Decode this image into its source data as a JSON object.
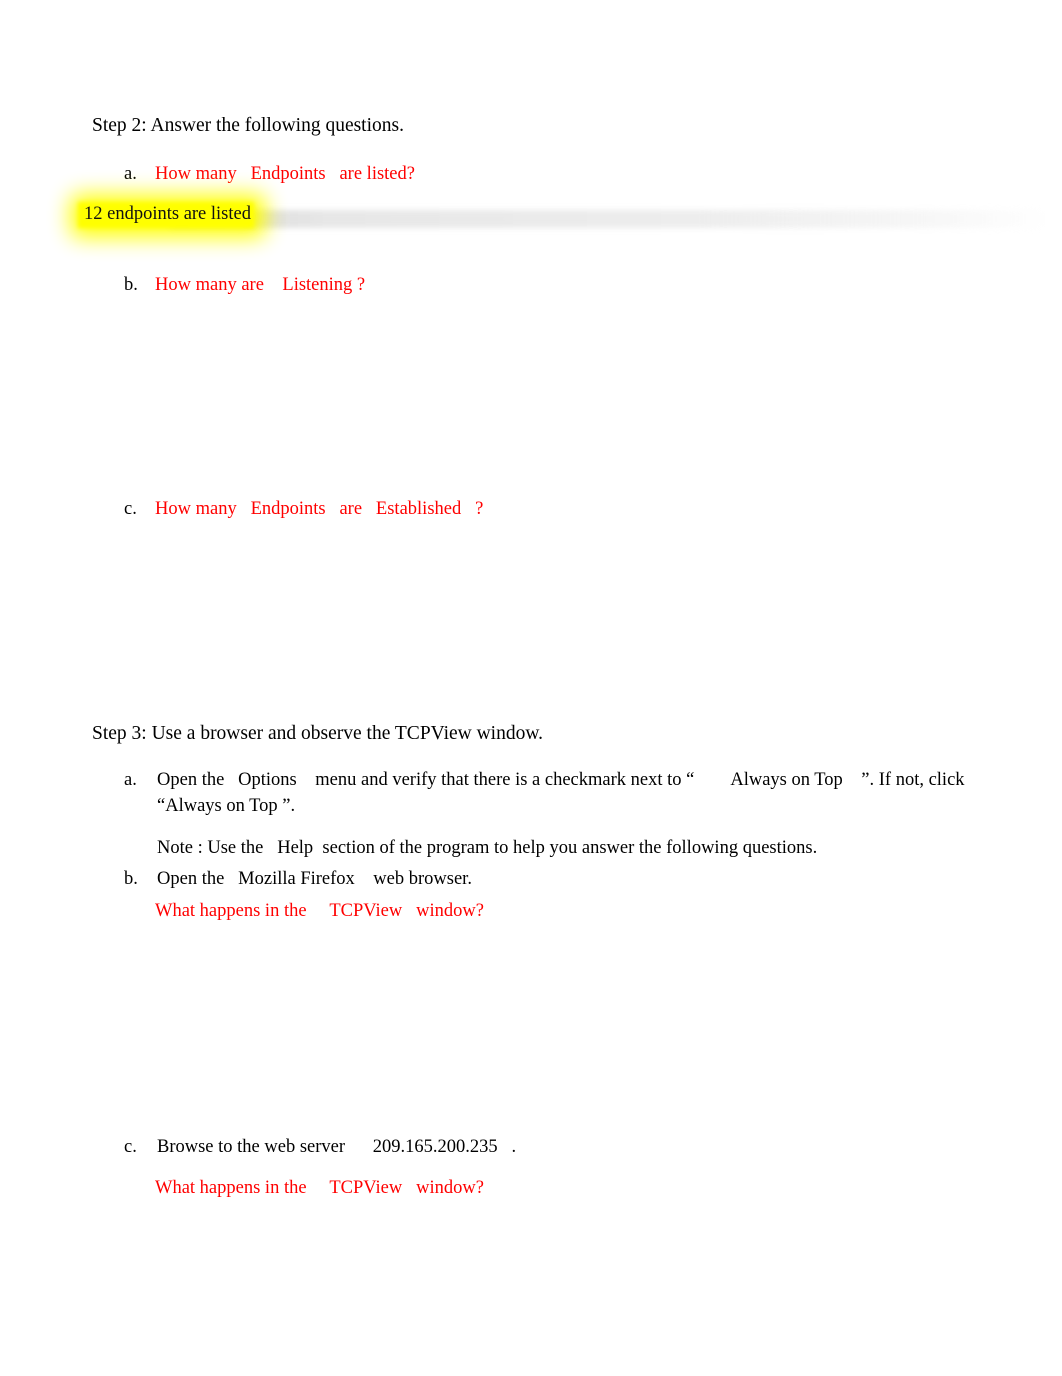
{
  "document": {
    "page_background": "#ffffff",
    "text_color": "#000000",
    "question_color": "#ff0000",
    "highlight_color": "#ffff00"
  },
  "step2": {
    "heading": "Step 2: Answer the following questions.",
    "items": [
      {
        "marker": "a.",
        "question": "How many   Endpoints   are listed?",
        "answer": "12 endpoints are listed",
        "answer_highlighted": true
      },
      {
        "marker": "b.",
        "question": "How many are    Listening ?",
        "answer": "",
        "answer_highlighted": false
      },
      {
        "marker": "c.",
        "question": "How many   Endpoints   are   Established   ?",
        "answer": "",
        "answer_highlighted": false
      }
    ]
  },
  "step3": {
    "heading": "Step 3: Use a browser and observe the TCPView window.",
    "items": [
      {
        "marker": "a.",
        "instruction": "Open the   Options    menu and verify that there is a checkmark next to “        Always on Top    ”. If not, click “Always on Top ”.",
        "note": "Note : Use the   Help  section of the program to help you answer the following questions."
      },
      {
        "marker": "b.",
        "instruction": "Open the   Mozilla Firefox    web browser.",
        "question": "What happens in the     TCPView   window?",
        "answer": ""
      },
      {
        "marker": "c.",
        "instruction": "Browse to the web server      209.165.200.235   .",
        "question": "What happens in the     TCPView   window?",
        "answer": ""
      }
    ]
  }
}
